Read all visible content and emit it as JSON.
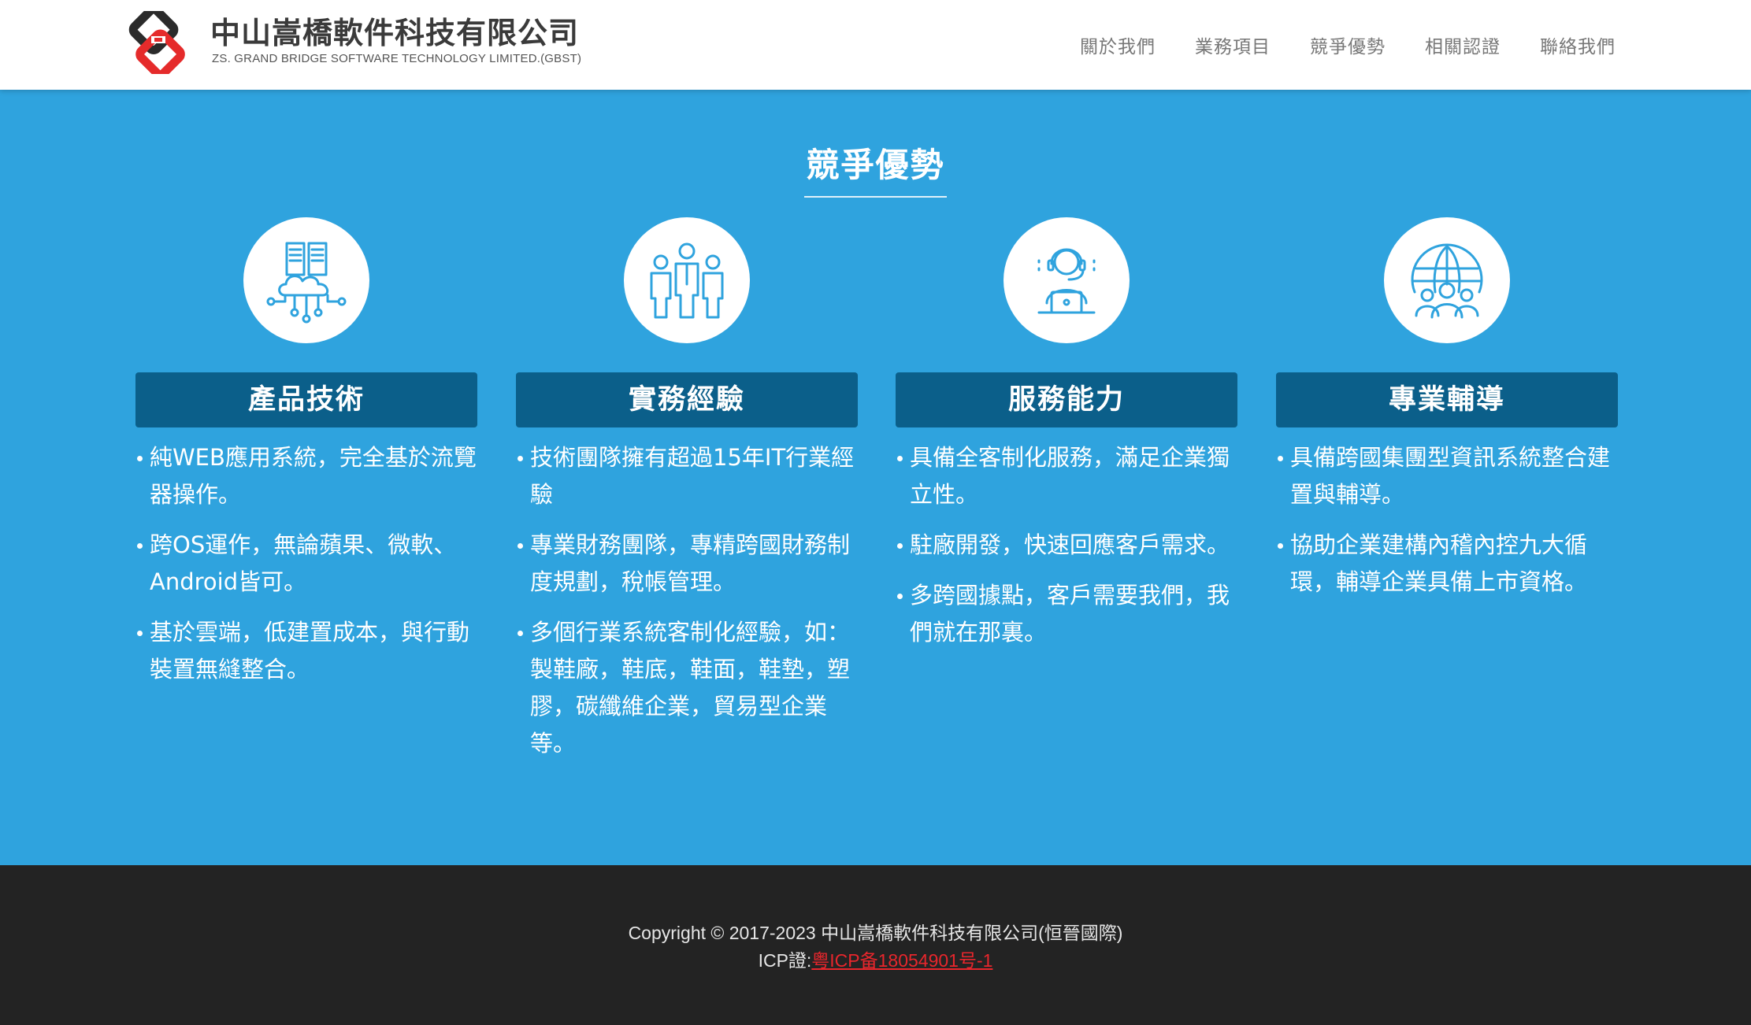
{
  "brand": {
    "name_cn": "中山嵩橋軟件科技有限公司",
    "name_en": "ZS. GRAND BRIDGE SOFTWARE TECHNOLOGY LIMITED.(GBST)",
    "logo_icon": "gbst-logo-icon",
    "colors": {
      "dark": "#2b2b2b",
      "red": "#e52b2b"
    }
  },
  "nav": {
    "items": [
      {
        "label": "關於我們"
      },
      {
        "label": "業務項目"
      },
      {
        "label": "競爭優勢"
      },
      {
        "label": "相關認證"
      },
      {
        "label": "聯絡我們"
      }
    ]
  },
  "section": {
    "title": "競爭優勢",
    "background": "#2fa3de",
    "bar_color": "#0b5f8a",
    "columns": [
      {
        "icon": "cloud-server-icon",
        "heading": "產品技術",
        "items": [
          "純WEB應用系統，完全基於流覽器操作。",
          "跨OS運作，無論蘋果、微軟、Android皆可。",
          "基於雲端，低建置成本，與行動裝置無縫整合。"
        ]
      },
      {
        "icon": "team-icon",
        "heading": "實務經驗",
        "items": [
          "技術團隊擁有超過15年IT行業經驗",
          "專業財務團隊，專精跨國財務制度規劃，稅帳管理。",
          "多個行業系統客制化經驗，如：製鞋廠，鞋底，鞋面，鞋墊，塑膠，碳纖維企業，貿易型企業等。"
        ]
      },
      {
        "icon": "customer-support-icon",
        "heading": "服務能力",
        "items": [
          "具備全客制化服務，滿足企業獨立性。",
          "駐廠開發，快速回應客戶需求。",
          "多跨國據點，客戶需要我們，我們就在那裏。"
        ]
      },
      {
        "icon": "global-people-icon",
        "heading": "專業輔導",
        "items": [
          "具備跨國集團型資訊系統整合建置與輔導。",
          "協助企業建構內稽內控九大循環，輔導企業具備上市資格。"
        ]
      }
    ]
  },
  "footer": {
    "copyright": "Copyright © 2017-2023 中山嵩橋軟件科技有限公司(恒晉國際)",
    "icp_prefix": "ICP證:",
    "icp_link": "粤ICP备18054901号-1",
    "link_color": "#e8262c"
  }
}
